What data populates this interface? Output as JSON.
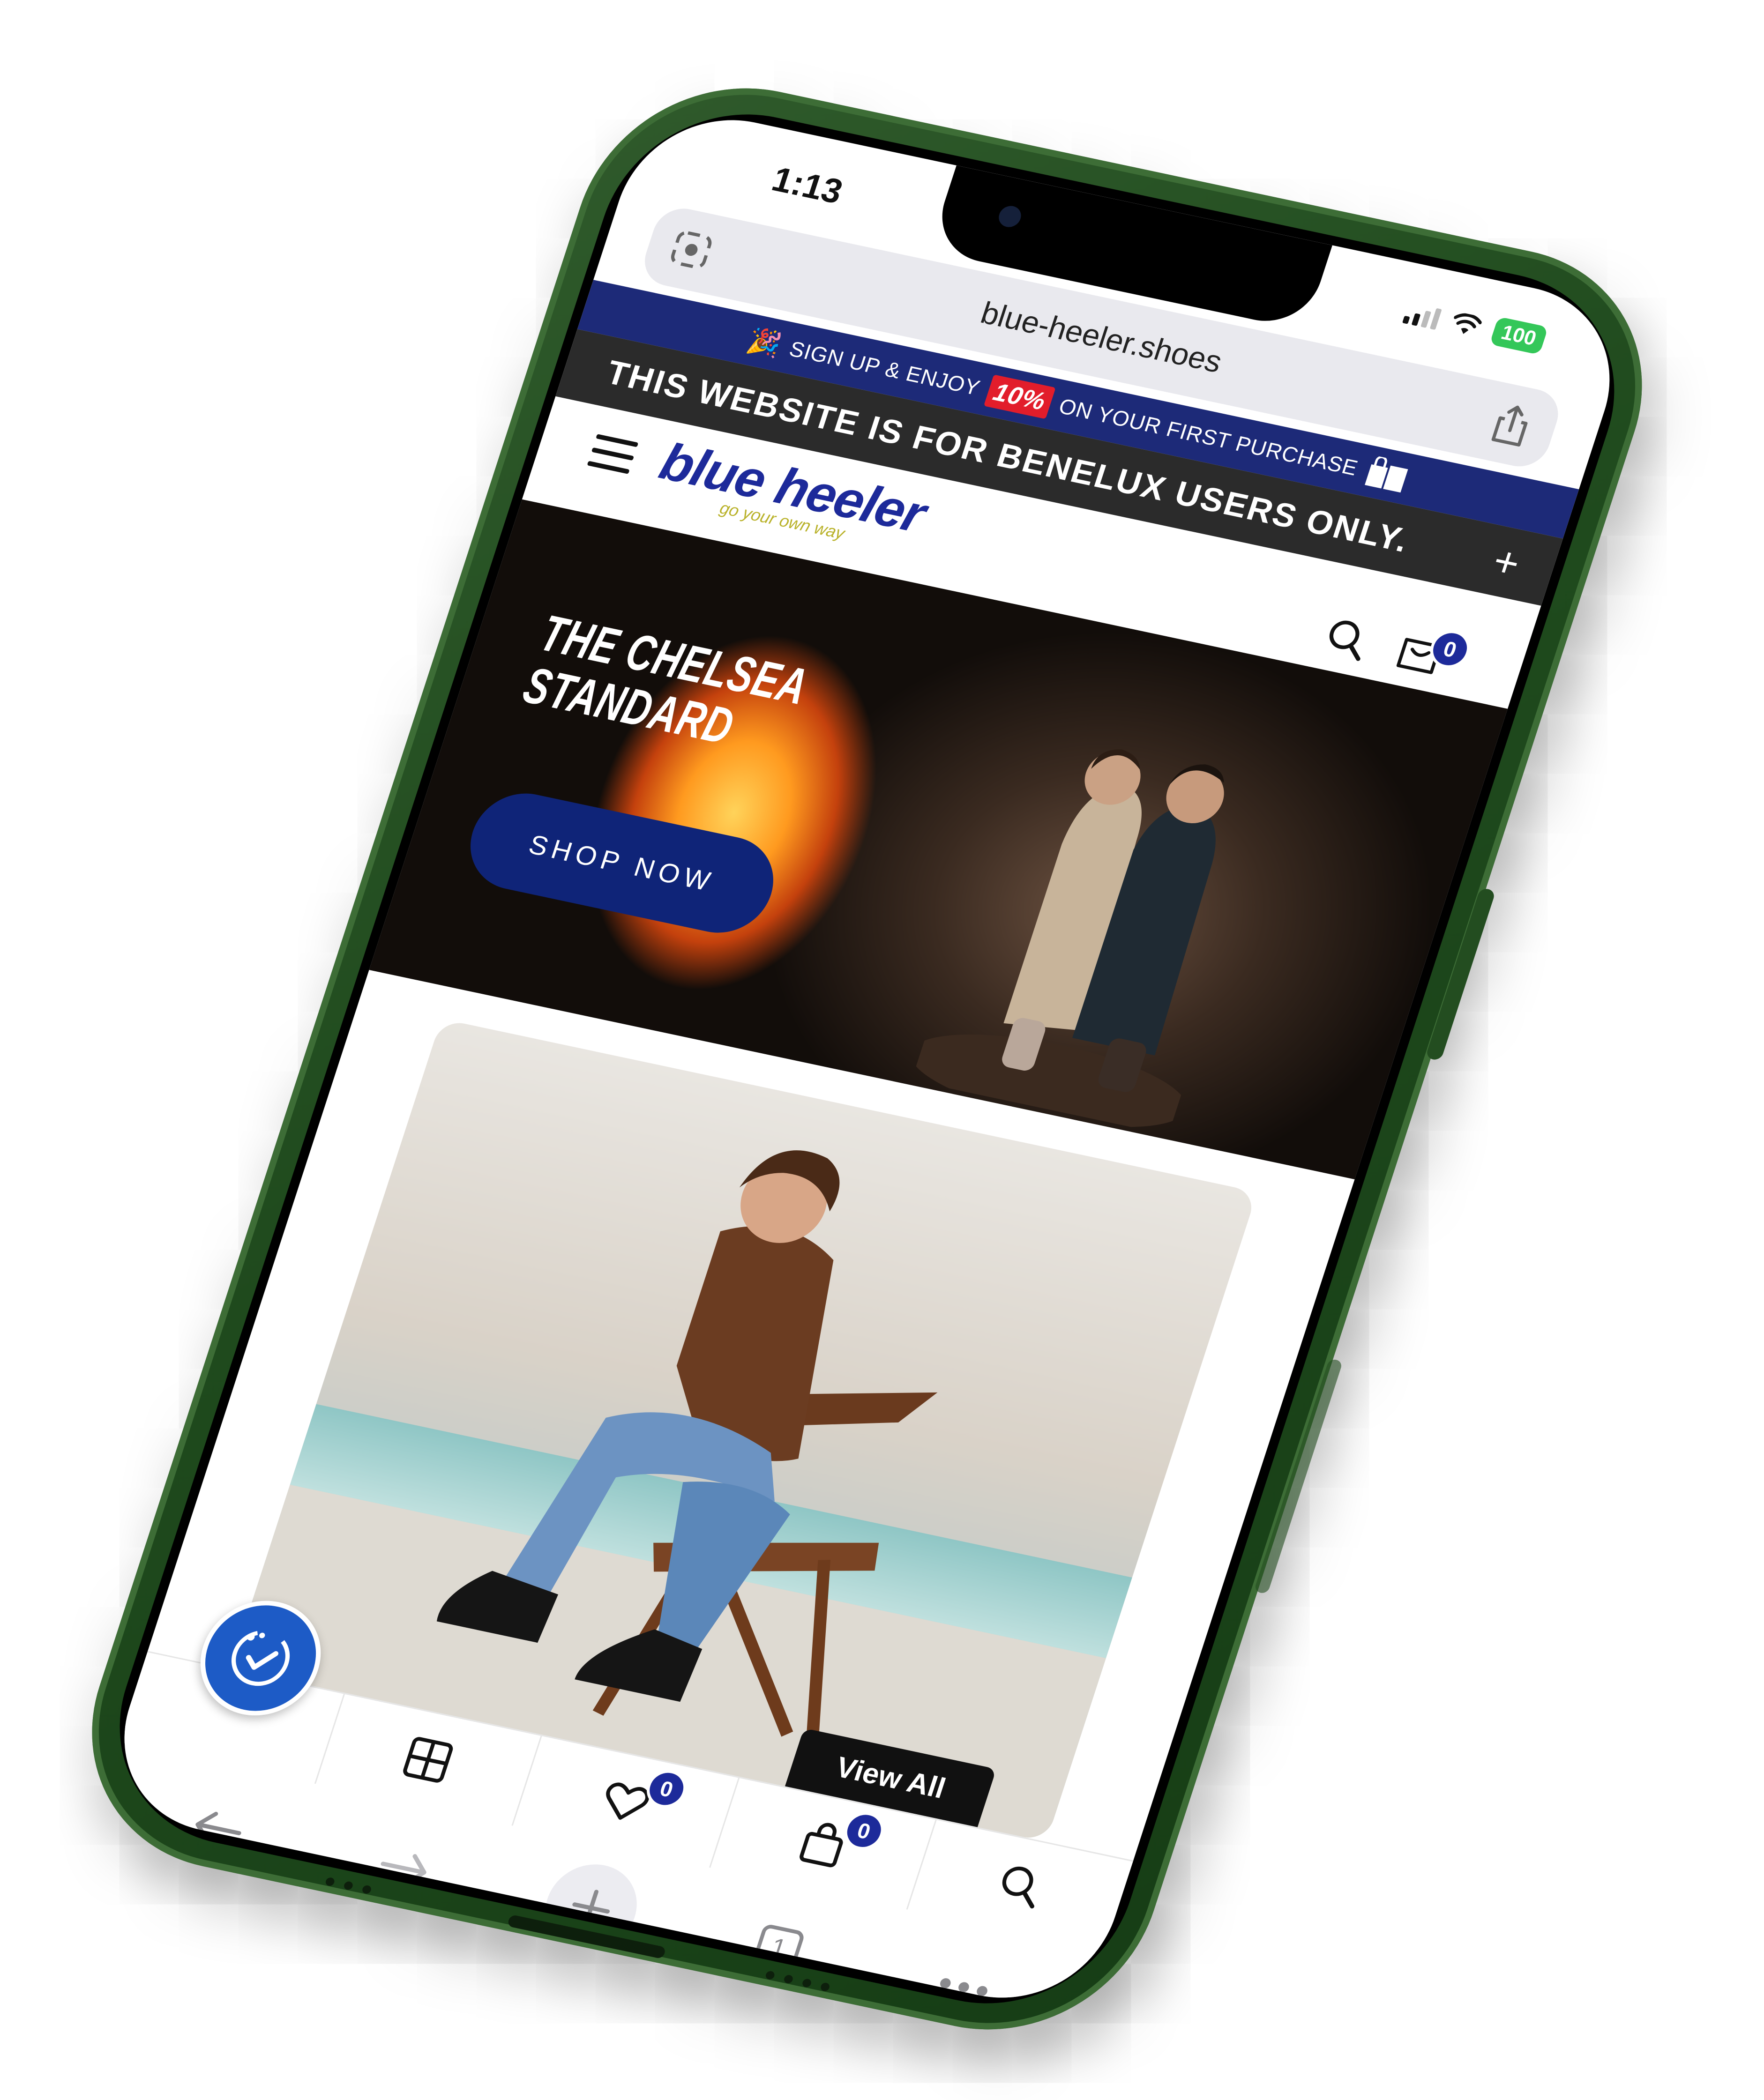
{
  "status_bar": {
    "time": "1:13",
    "battery": "100"
  },
  "browser": {
    "url": "blue-heeler.shoes",
    "tab_count": "1"
  },
  "promo": {
    "signup_prefix": "SIGN UP & ENJOY",
    "discount": "10%",
    "signup_suffix": "ON YOUR FIRST PURCHASE",
    "region_notice": "THIS WEBSITE IS FOR BENELUX USERS ONLY.",
    "close_symbol": "+"
  },
  "header": {
    "logo_text": "blue heeler",
    "logo_tagline": "go your own way",
    "cart_count": "0"
  },
  "hero": {
    "title": "THE CHELSEA\nSTANDARD",
    "cta": "SHOP NOW"
  },
  "product_card": {
    "view_all": "View All"
  },
  "bottom_nav": {
    "wishlist_count": "0",
    "bag_count": "0"
  },
  "colors": {
    "brand_blue": "#1d2a9a",
    "phone_green": "#1f4a1d",
    "promo_navy": "#1d2a78",
    "discount_red": "#e21d2b"
  }
}
